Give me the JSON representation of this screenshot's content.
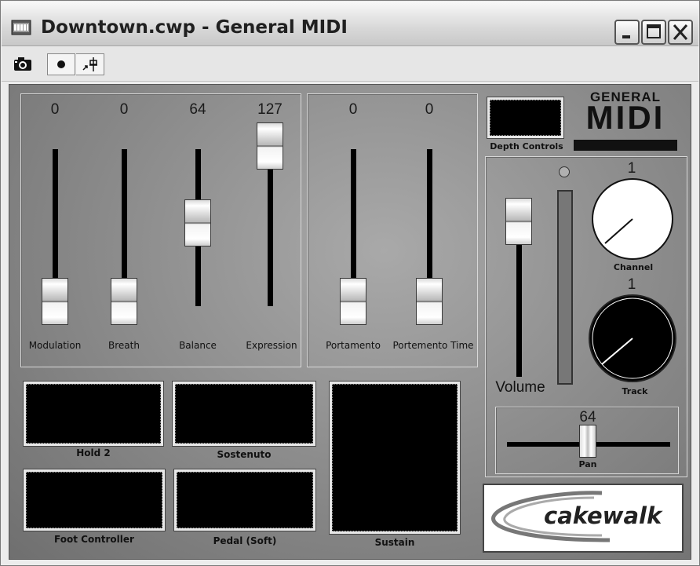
{
  "window": {
    "title": "Downtown.cwp - General MIDI"
  },
  "toolbar": {
    "buttons": [
      {
        "icon": "camera-icon"
      },
      {
        "icon": "record-icon"
      },
      {
        "icon": "pin-arrow-icon"
      }
    ]
  },
  "sliders_left": [
    {
      "label": "Modulation",
      "value": "0"
    },
    {
      "label": "Breath",
      "value": "0"
    },
    {
      "label": "Balance",
      "value": "64"
    },
    {
      "label": "Expression",
      "value": "127"
    }
  ],
  "sliders_right": [
    {
      "label": "Portamento",
      "value": "0"
    },
    {
      "label": "Portemento Time",
      "value": "0"
    }
  ],
  "depth_controls": {
    "label": "Depth Controls"
  },
  "logo": {
    "line1": "GENERAL",
    "line2": "MIDI"
  },
  "volume": {
    "label": "Volume"
  },
  "channel": {
    "label": "Channel",
    "value": "1"
  },
  "track": {
    "label": "Track",
    "value": "1"
  },
  "pan": {
    "label": "Pan",
    "value": "64"
  },
  "pads": [
    {
      "label": "Hold 2"
    },
    {
      "label": "Sostenuto"
    },
    {
      "label": "Foot Controller"
    },
    {
      "label": "Pedal (Soft)"
    },
    {
      "label": "Sustain"
    }
  ],
  "brand": {
    "name": "cakewalk"
  }
}
